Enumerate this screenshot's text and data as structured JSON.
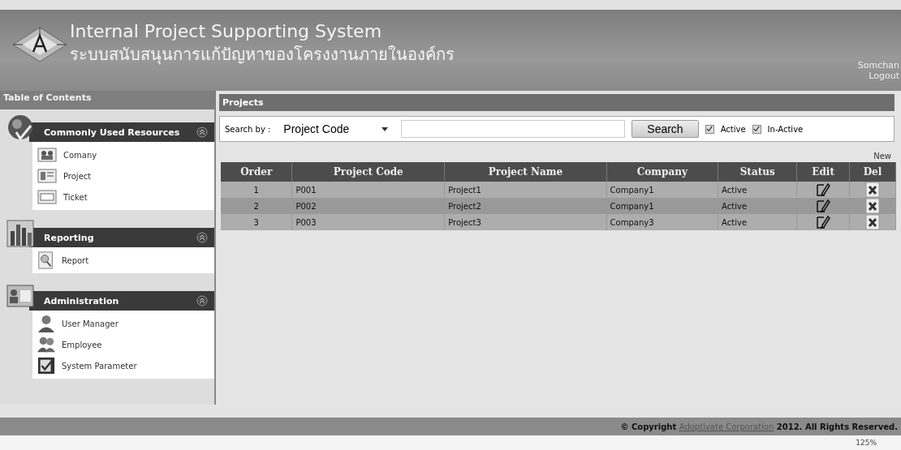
{
  "header": {
    "title": "Internal Project Supporting System",
    "subtitle": "ระบบสนับสนุนการแก้ปัญหาของโครงงานภายในองค์กร",
    "user": "Somchan",
    "logout": "Logout"
  },
  "sidebar": {
    "title": "Table of Contents",
    "sections": [
      {
        "kind": "resources",
        "title": "Commonly Used Resources",
        "expanded": true,
        "items": [
          {
            "kind": "company",
            "label": "Comany"
          },
          {
            "kind": "project",
            "label": "Project"
          },
          {
            "kind": "ticket",
            "label": "Ticket"
          }
        ]
      },
      {
        "kind": "reporting",
        "title": "Reporting",
        "expanded": true,
        "items": [
          {
            "kind": "report",
            "label": "Report"
          }
        ]
      },
      {
        "kind": "admin",
        "title": "Administration",
        "expanded": true,
        "items": [
          {
            "kind": "user",
            "label": "User Manager"
          },
          {
            "kind": "employee",
            "label": "Employee"
          },
          {
            "kind": "parameter",
            "label": "System Parameter"
          }
        ]
      }
    ]
  },
  "panel": {
    "title": "Projects",
    "search_label": "Search by :",
    "search_by": "Project Code",
    "search_button": "Search",
    "filters": [
      {
        "label": "Active",
        "checked": true
      },
      {
        "label": "In-Active",
        "checked": true
      }
    ],
    "new_link": "New",
    "table": {
      "columns": [
        "Order",
        "Project Code",
        "Project Name",
        "Company",
        "Status",
        "Edit",
        "Del"
      ],
      "rows": [
        {
          "order": "1",
          "code": "P001",
          "name": "Project1",
          "company": "Company1",
          "status": "Active"
        },
        {
          "order": "2",
          "code": "P002",
          "name": "Project2",
          "company": "Company1",
          "status": "Active"
        },
        {
          "order": "3",
          "code": "P003",
          "name": "Project3",
          "company": "Company3",
          "status": "Active"
        }
      ]
    }
  },
  "footer": {
    "before": "© Copyright",
    "link": "Adoptivate Corporation",
    "after": "2012. All Rights Reserved."
  },
  "status_bar": {
    "zoom": "125%"
  }
}
